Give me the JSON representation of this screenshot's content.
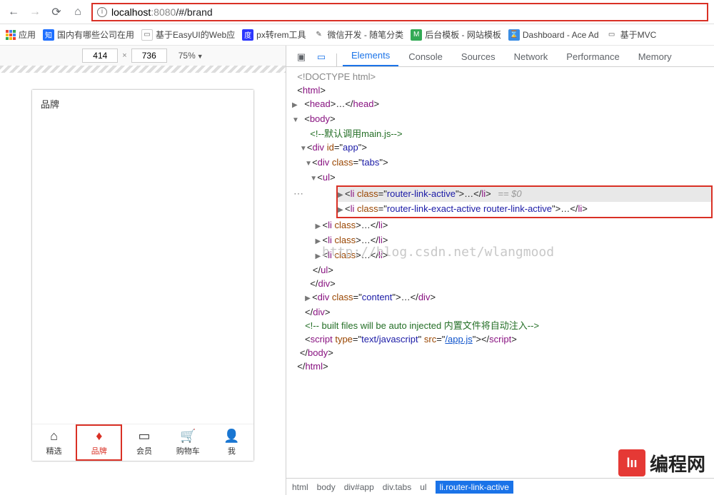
{
  "chrome": {
    "url_host": "localhost",
    "url_port": ":8080",
    "url_path": "/#/brand"
  },
  "bookmarks": [
    {
      "label": "应用",
      "color": ""
    },
    {
      "label": "国内有哪些公司在用",
      "color": "#1e6fff"
    },
    {
      "label": "基于EasyUI的Web应",
      "color": ""
    },
    {
      "label": "px转rem工具",
      "color": "#1e3bff"
    },
    {
      "label": "微信开发 - 随笔分类",
      "color": ""
    },
    {
      "label": "后台模板 - 网站模板",
      "color": "#33aa55"
    },
    {
      "label": "Dashboard - Ace Ad",
      "color": "#3b8de3"
    },
    {
      "label": "基于MVC",
      "color": ""
    }
  ],
  "deviceBar": {
    "w": "414",
    "h": "736",
    "zoom": "75%"
  },
  "phone": {
    "title": "品牌",
    "tabs": [
      {
        "label": "精选",
        "icon": "⌂"
      },
      {
        "label": "品牌",
        "icon": "◇"
      },
      {
        "label": "会员",
        "icon": "☐"
      },
      {
        "label": "购物车",
        "icon": "🛒"
      },
      {
        "label": "我",
        "icon": "◯"
      }
    ],
    "activeTab": 1
  },
  "devtools": {
    "tabs": [
      "Elements",
      "Console",
      "Sources",
      "Network",
      "Performance",
      "Memory"
    ],
    "activeTab": 0,
    "crumbs": [
      "html",
      "body",
      "div#app",
      "div.tabs",
      "ul",
      "li.router-link-active"
    ],
    "dom": {
      "doctype": "<!DOCTYPE html>",
      "comment1": "<!--默认调用main.js-->",
      "appId": "app",
      "tabsClass": "tabs",
      "li1": "router-link-active",
      "li2": "router-link-exact-active router-link-active",
      "contentClass": "content",
      "comment2": "<!-- built files will be auto injected 内置文件将自动注入-->",
      "scriptType": "text/javascript",
      "scriptSrc": "/app.js",
      "eq": " == $0"
    }
  },
  "watermark": "http://blog.csdn.net/wlangmood",
  "brand": "编程网"
}
